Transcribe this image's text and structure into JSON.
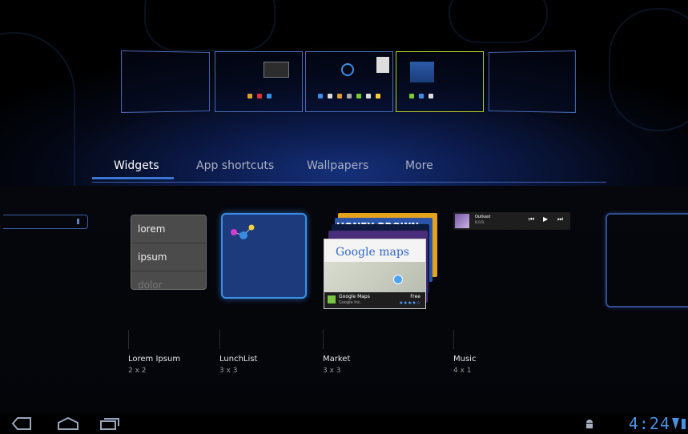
{
  "tabs": [
    {
      "label": "Widgets",
      "active": true
    },
    {
      "label": "App shortcuts",
      "active": false
    },
    {
      "label": "Wallpapers",
      "active": false
    },
    {
      "label": "More",
      "active": false
    }
  ],
  "widgets": [
    {
      "name": "Lorem Ipsum",
      "size": "2 x 2"
    },
    {
      "name": "LunchList",
      "size": "3 x 3"
    },
    {
      "name": "Market",
      "size": "3 x 3"
    },
    {
      "name": "Music",
      "size": "4 x 1"
    }
  ],
  "lorem_preview": {
    "items": [
      "lorem",
      "ipsum",
      "dolor"
    ]
  },
  "market_preview": {
    "banner_text": "HONEY BROWN",
    "logo_text": "Google maps",
    "app_name": "Google Maps",
    "developer": "Google Inc.",
    "price": "Free",
    "stars": "★★★★☆"
  },
  "music_preview": {
    "artist": "Outkast",
    "track": "B.O.B."
  },
  "status_bar": {
    "time": "4:24"
  },
  "colors": {
    "accent": "#3a76d6",
    "selected_panel": "#b7d21f",
    "clock": "#4b8fe0"
  }
}
